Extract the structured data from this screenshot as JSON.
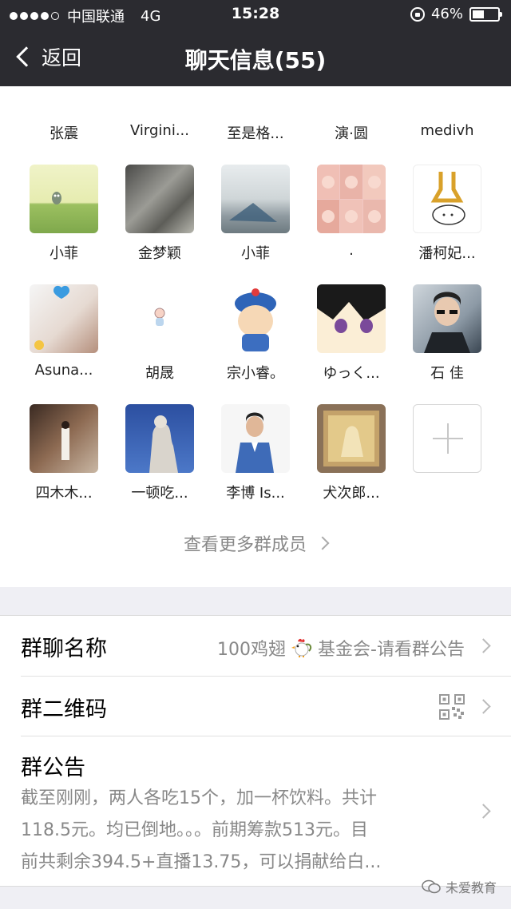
{
  "status_bar": {
    "carrier": "中国联通",
    "network": "4G",
    "time": "15:28",
    "battery": "46%",
    "battery_level": 0.46
  },
  "nav": {
    "back_label": "返回",
    "title": "聊天信息(55)"
  },
  "members": [
    {
      "name": "张震"
    },
    {
      "name": "Virgini..."
    },
    {
      "name": "至是格..."
    },
    {
      "name": "演·圆"
    },
    {
      "name": "medivh"
    },
    {
      "name": "小菲"
    },
    {
      "name": "金梦颖"
    },
    {
      "name": "小菲"
    },
    {
      "name": "."
    },
    {
      "name": "潘柯妃..."
    },
    {
      "name": "Asuna..."
    },
    {
      "name": "胡晟"
    },
    {
      "name": "宗小睿。"
    },
    {
      "name": "ゆっく..."
    },
    {
      "name": "石 佳"
    },
    {
      "name": "四木木..."
    },
    {
      "name": "一顿吃..."
    },
    {
      "name": "李博 Is..."
    },
    {
      "name": "犬次郎..."
    }
  ],
  "more_members_label": "查看更多群成员",
  "settings": {
    "group_name_label": "群聊名称",
    "group_name_value_prefix": "100鸡翅",
    "group_name_value_suffix": "基金会-请看群公告",
    "qr_label": "群二维码",
    "notice_label": "群公告",
    "notice_lines": [
      "截至刚刚，两人各吃15个，加一杯饮料。共计",
      "118.5元。均已倒地。。。前期筹款513元。目",
      "前共剩余394.5+直播13.75，可以捐献给白..."
    ]
  },
  "watermark": "未爱教育",
  "icons": {
    "back": "chevron-left-icon",
    "lock": "orientation-lock-icon",
    "battery": "battery-icon",
    "add": "plus-icon",
    "qr": "qr-code-icon",
    "rooster": "rooster-emoji-icon",
    "arrow": "chevron-right-icon"
  }
}
